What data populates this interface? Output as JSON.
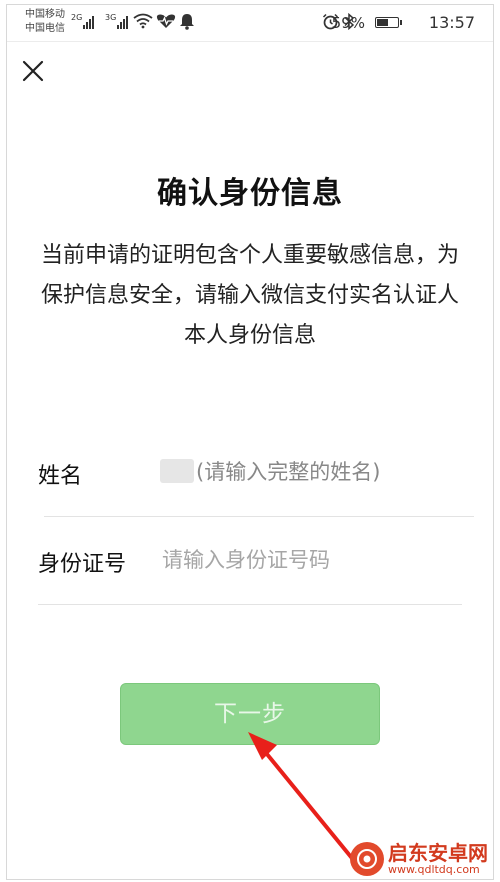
{
  "status_bar": {
    "carrier_1": "中国移动",
    "carrier_2": "中国电信",
    "signal_1_tag": "2G",
    "signal_2_tag": "3G",
    "battery_percent": "59%",
    "battery_level": 0.59,
    "time": "13:57",
    "icons": [
      "wifi-icon",
      "heartbeat-icon",
      "notification-bell-icon",
      "alarm-icon",
      "bluetooth-icon",
      "battery-icon"
    ]
  },
  "header": {
    "close_icon": "close-icon"
  },
  "main": {
    "title": "确认身份信息",
    "description": "当前申请的证明包含个人重要敏感信息，为保护信息安全，请输入微信支付实名认证人本人身份信息"
  },
  "form": {
    "name": {
      "label": "姓名",
      "value": "(请输入完整的姓名)"
    },
    "id_number": {
      "label": "身份证号",
      "placeholder": "请输入身份证号码"
    }
  },
  "actions": {
    "next_label": "下一步",
    "next_color": "#8fd68f"
  },
  "watermark": {
    "text": "启东安卓网",
    "url": "www.qdltdq.com"
  },
  "colors": {
    "annotation_arrow": "#e8201a"
  }
}
